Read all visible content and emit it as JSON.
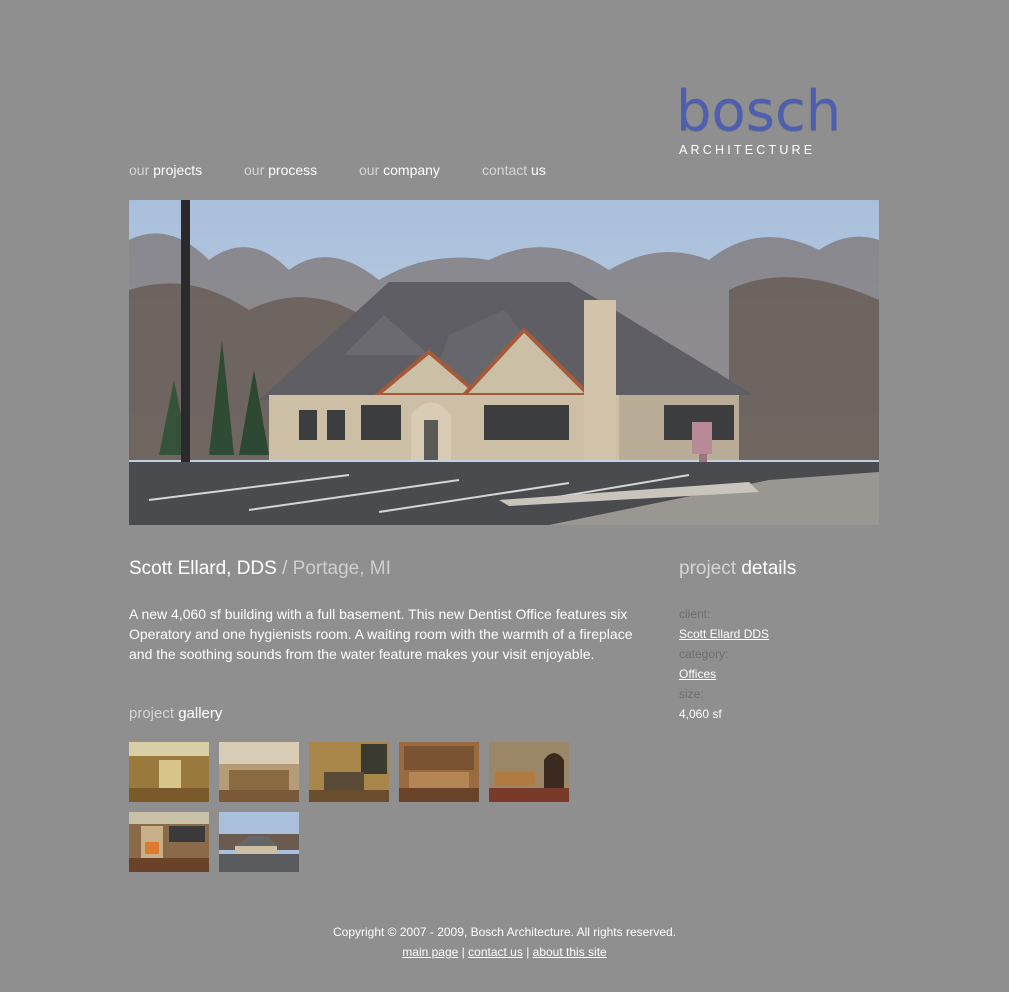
{
  "brand": {
    "name": "bosch",
    "sub": "ARCHITECTURE",
    "color": "#4e5fb0"
  },
  "nav": [
    {
      "dim": "our",
      "hi": "projects"
    },
    {
      "dim": "our",
      "hi": "process"
    },
    {
      "dim": "our",
      "hi": "company"
    },
    {
      "dim": "contact",
      "hi": "us"
    }
  ],
  "project": {
    "name": "Scott Ellard, DDS",
    "location": "/ Portage, MI",
    "description": "A new 4,060 sf building with a full basement. This new Dentist Office features six Operatory and one hygienists room. A waiting room with the warmth of a fireplace and the soothing sounds from the water feature makes your visit enjoyable."
  },
  "gallery": {
    "dim": "project",
    "hi": "gallery",
    "thumb_count": 7
  },
  "details": {
    "heading_dim": "project",
    "heading_hi": "details",
    "client_label": "client:",
    "client_value": "Scott Ellard DDS",
    "category_label": "category:",
    "category_value": "Offices",
    "size_label": "size:",
    "size_value": "4,060 sf"
  },
  "footer": {
    "copyright": "Copyright © 2007 - 2009, Bosch Architecture. All rights reserved.",
    "links": [
      "main page",
      "contact us",
      "about this site"
    ],
    "separator": "|"
  }
}
